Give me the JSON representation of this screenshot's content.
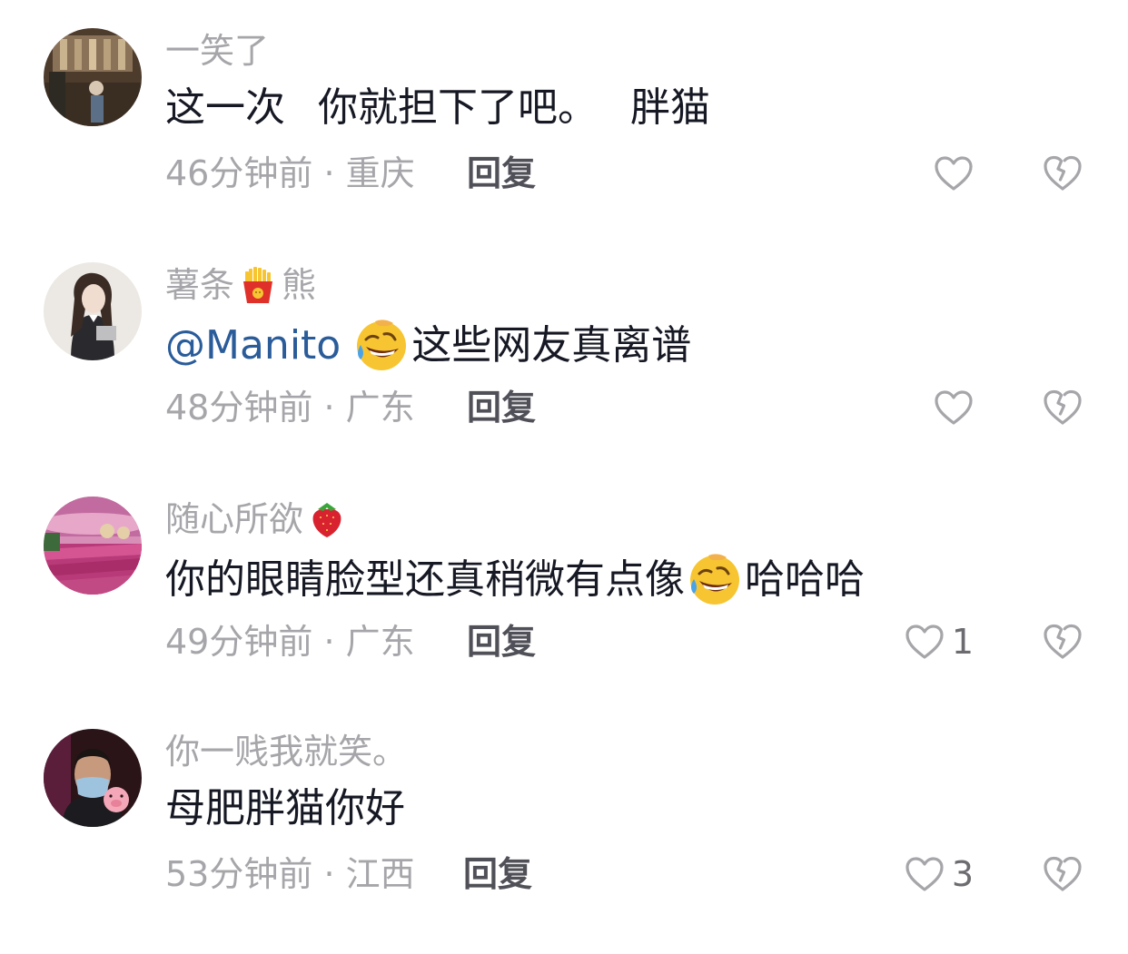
{
  "comments": [
    {
      "username": "一笑了",
      "text_a": "这一次",
      "text_b": "你就担下了吧。",
      "text_c": "胖猫",
      "time": "46分钟前",
      "location": "重庆",
      "reply_label": "回复",
      "likes": ""
    },
    {
      "username_a": "薯条",
      "username_b": "熊",
      "badge_icon": "fries-emoji",
      "mention": "@Manito",
      "text": "这些网友真离谱",
      "inline_icon": "rolling-laugh-emoji",
      "time": "48分钟前",
      "location": "广东",
      "reply_label": "回复",
      "likes": ""
    },
    {
      "username": "随心所欲",
      "badge_icon": "strawberry-emoji",
      "text_a": "你的眼睛脸型还真稍微有点像",
      "text_b": "哈哈哈",
      "inline_icon": "rolling-laugh-emoji",
      "time": "49分钟前",
      "location": "广东",
      "reply_label": "回复",
      "likes": "1"
    },
    {
      "username": "你一贱我就笑。",
      "text": "母肥胖猫你好",
      "time": "53分钟前",
      "location": "江西",
      "reply_label": "回复",
      "likes": "3"
    }
  ],
  "separator": "·",
  "colors": {
    "username": "#a6a6aa",
    "body": "#161823",
    "mention": "#2a5c9a",
    "meta": "#a6a6aa",
    "reply": "#505058"
  }
}
